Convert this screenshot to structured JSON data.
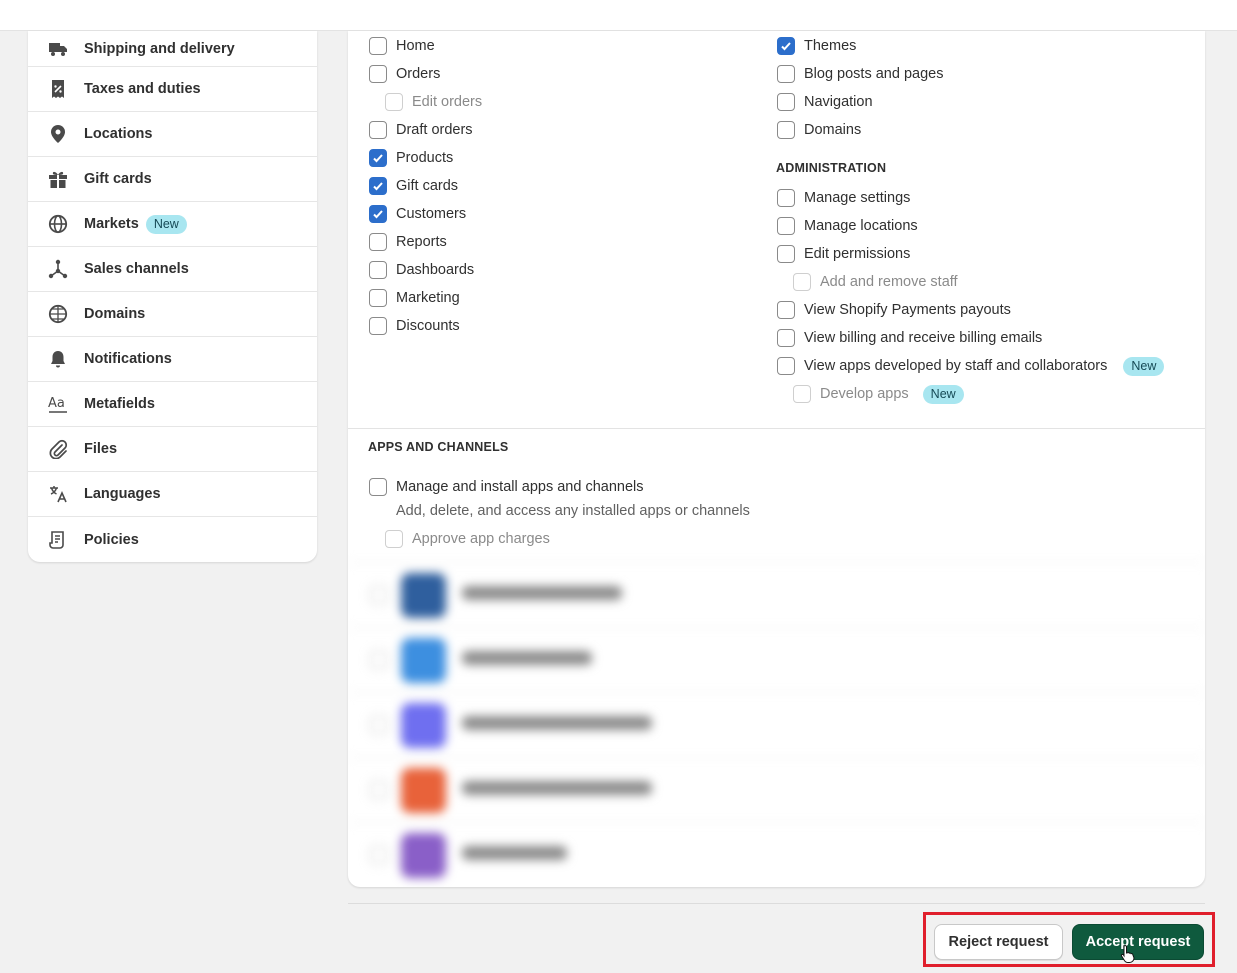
{
  "sidebar": {
    "items": [
      {
        "label": "Shipping and delivery",
        "icon": "truck-icon"
      },
      {
        "label": "Taxes and duties",
        "icon": "receipt-percent-icon"
      },
      {
        "label": "Locations",
        "icon": "location-pin-icon"
      },
      {
        "label": "Gift cards",
        "icon": "gift-icon"
      },
      {
        "label": "Markets",
        "icon": "globe-icon",
        "badge": "New"
      },
      {
        "label": "Sales channels",
        "icon": "channels-icon"
      },
      {
        "label": "Domains",
        "icon": "globe-grid-icon"
      },
      {
        "label": "Notifications",
        "icon": "bell-icon"
      },
      {
        "label": "Metafields",
        "icon": "text-aa-icon"
      },
      {
        "label": "Files",
        "icon": "paperclip-icon"
      },
      {
        "label": "Languages",
        "icon": "translate-icon"
      },
      {
        "label": "Policies",
        "icon": "document-icon"
      }
    ]
  },
  "permissions": {
    "left": [
      {
        "label": "Home",
        "checked": false
      },
      {
        "label": "Orders",
        "checked": false
      },
      {
        "label": "Edit orders",
        "checked": false,
        "disabled": true
      },
      {
        "label": "Draft orders",
        "checked": false
      },
      {
        "label": "Products",
        "checked": true
      },
      {
        "label": "Gift cards",
        "checked": true
      },
      {
        "label": "Customers",
        "checked": true
      },
      {
        "label": "Reports",
        "checked": false
      },
      {
        "label": "Dashboards",
        "checked": false
      },
      {
        "label": "Marketing",
        "checked": false
      },
      {
        "label": "Discounts",
        "checked": false
      }
    ],
    "right": [
      {
        "label": "Themes",
        "checked": true
      },
      {
        "label": "Blog posts and pages",
        "checked": false
      },
      {
        "label": "Navigation",
        "checked": false
      },
      {
        "label": "Domains",
        "checked": false
      }
    ],
    "administration_heading": "ADMINISTRATION",
    "administration": [
      {
        "label": "Manage settings",
        "checked": false
      },
      {
        "label": "Manage locations",
        "checked": false
      },
      {
        "label": "Edit permissions",
        "checked": false
      },
      {
        "label": "Add and remove staff",
        "checked": false,
        "disabled": true
      },
      {
        "label": "View Shopify Payments payouts",
        "checked": false
      },
      {
        "label": "View billing and receive billing emails",
        "checked": false
      },
      {
        "label": "View apps developed by staff and collaborators",
        "checked": false,
        "badge": "New"
      },
      {
        "label": "Develop apps",
        "checked": false,
        "disabled": true,
        "badge": "New"
      }
    ]
  },
  "apps_channels": {
    "heading": "APPS AND CHANNELS",
    "manage_label": "Manage and install apps and channels",
    "manage_helper": "Add, delete, and access any installed apps or channels",
    "approve_label": "Approve app charges",
    "apps": [
      {
        "color": "#2f5f9e"
      },
      {
        "color": "#3d8fe0"
      },
      {
        "color": "#6f6ff0"
      },
      {
        "color": "#e8623a"
      },
      {
        "color": "#8a5fc8"
      }
    ]
  },
  "actions": {
    "reject_label": "Reject request",
    "accept_label": "Accept request"
  },
  "colors": {
    "accent_green": "#0f5a3e",
    "checkbox_blue": "#2c6ecb",
    "highlight_red": "#e01f2c",
    "badge_bg": "#a8e6f0"
  }
}
